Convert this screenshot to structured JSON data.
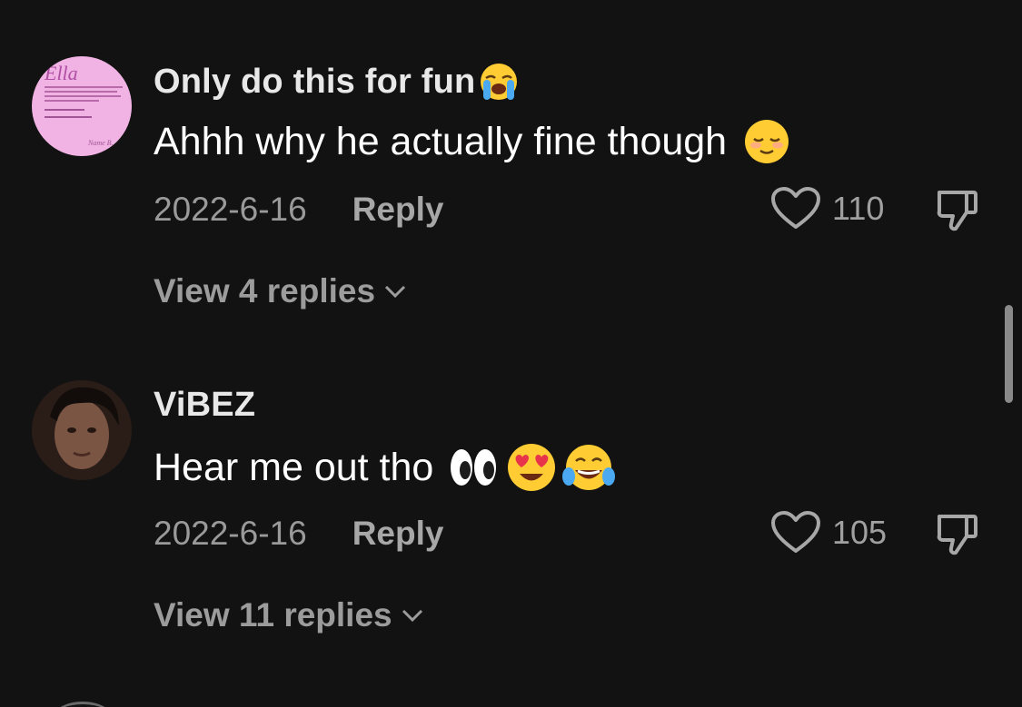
{
  "comments": [
    {
      "username": "Only do this for fun",
      "username_emoji": "loudly-crying-face-emoji",
      "text": "Ahhh why he actually fine though",
      "text_emojis": [
        "relieved-face-emoji"
      ],
      "date": "2022-6-16",
      "reply_label": "Reply",
      "likes": "110",
      "view_replies": "View 4 replies",
      "avatar": {
        "title": "Ella",
        "body": "Ella comes from the root ali- meaning other in German or goddess in Hebrew and is also a diminutive of Eleanor and variant form of...",
        "origin_label": "Origin",
        "origin_value": "Hebrew",
        "pronunciation_label": "Pronunciation",
        "pronunciation_value": "el-ah",
        "signature": "Name B."
      }
    },
    {
      "username": "ViBEZ",
      "text": "Hear me out tho",
      "text_emojis": [
        "eyes-emoji",
        "heart-eyes-emoji",
        "tears-of-joy-emoji"
      ],
      "date": "2022-6-16",
      "reply_label": "Reply",
      "likes": "105",
      "view_replies": "View 11 replies"
    }
  ],
  "colors": {
    "background": "#121212",
    "username": "#e8e8e8",
    "text": "#ffffff",
    "meta": "#9a9a9a",
    "avatar_pink": "#f1b3e4"
  }
}
